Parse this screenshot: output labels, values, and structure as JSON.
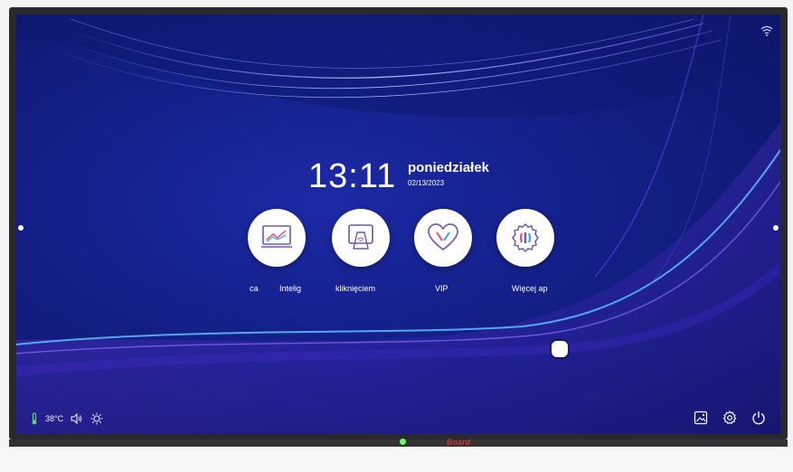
{
  "clock": {
    "time": "13:11",
    "day": "poniedziałek",
    "date": "02/13/2023"
  },
  "apps": [
    {
      "label": "ca",
      "icon": "whiteboard-icon"
    },
    {
      "label": "Intelig",
      "icon": "screen-share-icon"
    },
    {
      "label": "kliknięciem",
      "icon": "screen-share-icon"
    },
    {
      "label": "VIP",
      "icon": "heart-icon"
    },
    {
      "label": "Więcej ap",
      "icon": "more-apps-icon"
    }
  ],
  "status": {
    "temperature": "38°C",
    "icons": [
      "thermometer-icon",
      "volume-icon",
      "brightness-icon"
    ]
  },
  "tray": {
    "icons": [
      "wallpaper-icon",
      "settings-icon",
      "power-icon"
    ]
  },
  "brand": {
    "name": "Board"
  },
  "colors": {
    "background": "#14208a",
    "accent": "#ffffff",
    "power_led": "#66ff66"
  }
}
